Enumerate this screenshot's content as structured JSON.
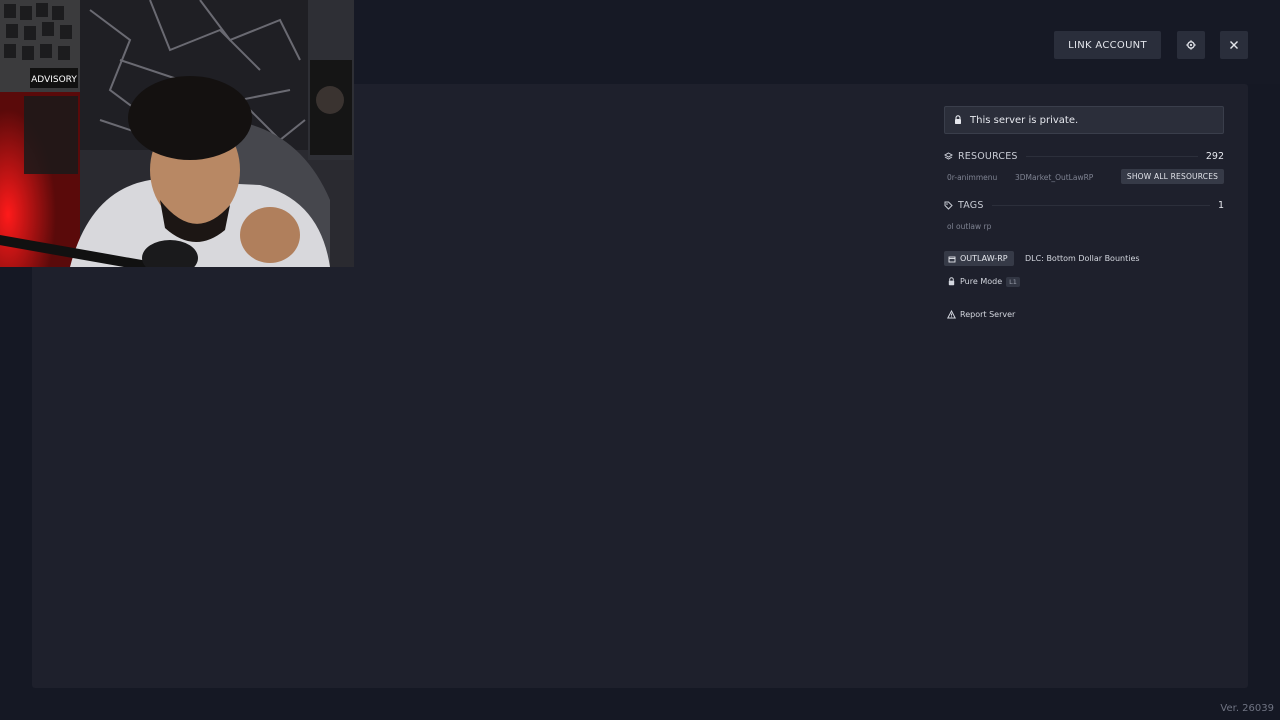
{
  "header": {
    "link_account_label": "LINK ACCOUNT",
    "settings_icon": "gear-icon",
    "close_icon": "close-icon"
  },
  "webcam": {
    "poster_text": "ADVISORY"
  },
  "server": {
    "private_message": "This server is private.",
    "resources": {
      "label": "RESOURCES",
      "count": "292",
      "items": [
        "0r-animmenu",
        "3DMarket_OutLawRP"
      ],
      "show_all_label": "SHOW ALL RESOURCES"
    },
    "tags": {
      "label": "TAGS",
      "count": "1",
      "items": [
        "ol outlaw rp"
      ]
    },
    "badges": {
      "project_label": "OUTLAW-RP",
      "dlc_label": "DLC: Bottom Dollar Bounties",
      "pure_mode_label": "Pure Mode",
      "pure_mode_level": "L1"
    },
    "report_label": "Report Server"
  },
  "footer": {
    "version": "Ver. 26039"
  },
  "colors": {
    "background": "#151824",
    "panel": "#1e202c",
    "button": "#2a2e3b",
    "text": "#e2e4ea",
    "muted": "#7f8392"
  }
}
